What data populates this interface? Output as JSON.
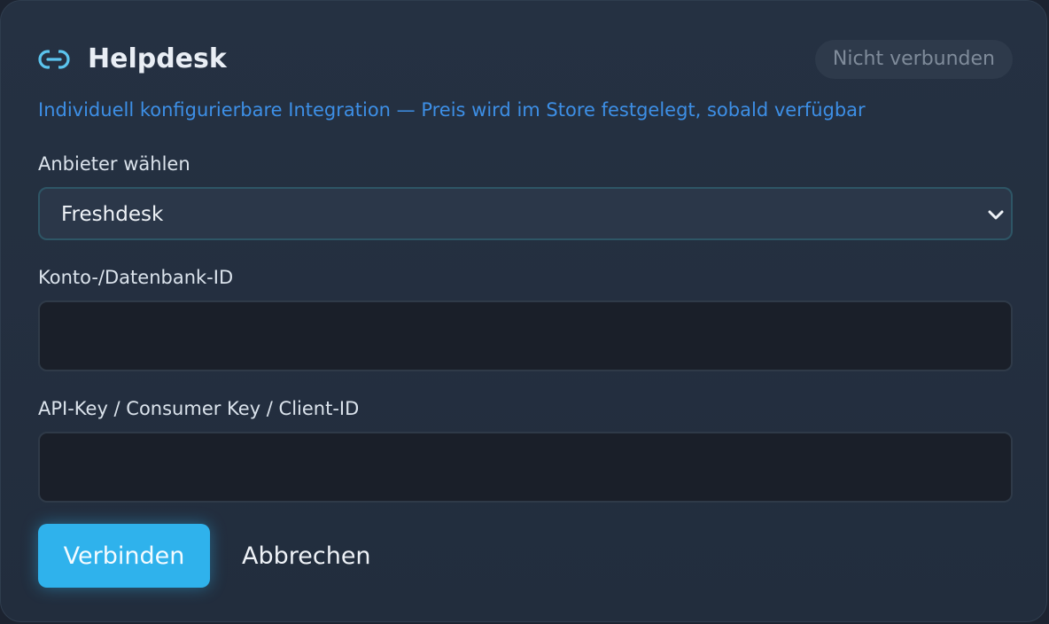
{
  "header": {
    "icon": "link-icon",
    "title": "Helpdesk",
    "status": "Nicht verbunden"
  },
  "subtitle": "Individuell konfigurierbare Integration — Preis wird im Store festgelegt, sobald verfügbar",
  "form": {
    "provider_label": "Anbieter wählen",
    "provider_value": "Freshdesk",
    "account_label": "Konto-/Datenbank-ID",
    "account_value": "",
    "api_label": "API-Key / Consumer Key / Client-ID",
    "api_value": ""
  },
  "actions": {
    "connect_label": "Verbinden",
    "cancel_label": "Abbrechen"
  },
  "colors": {
    "accent": "#2fb2ec",
    "link": "#3d8fe6",
    "card_bg": "#243042"
  }
}
